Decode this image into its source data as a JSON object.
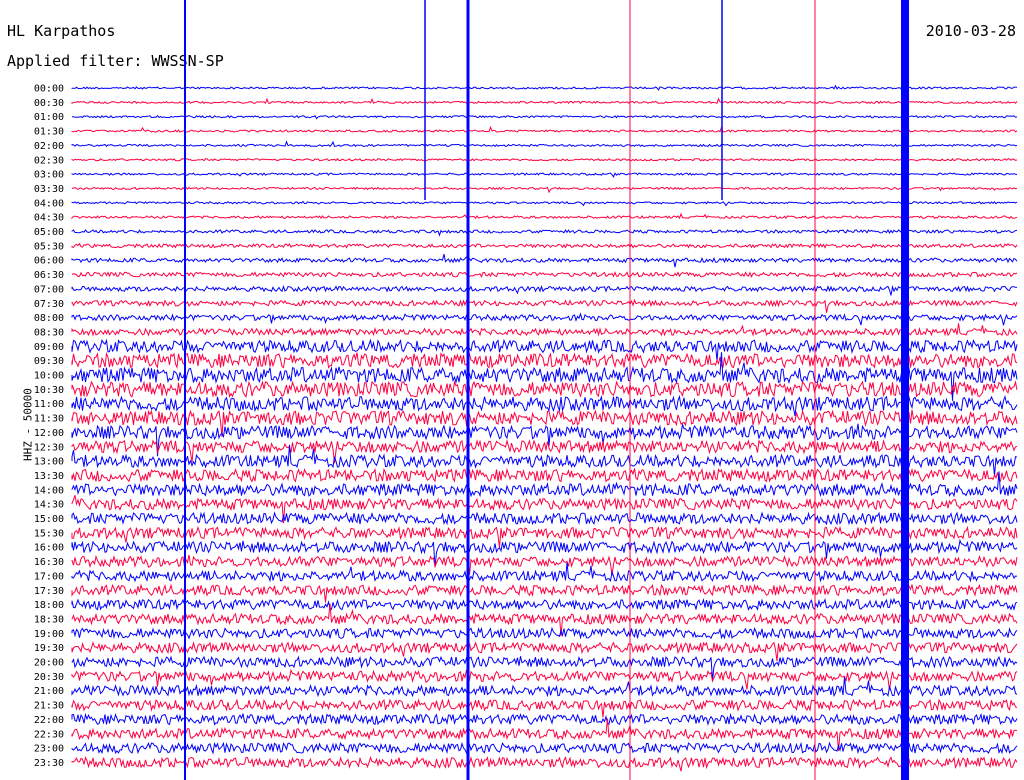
{
  "header": {
    "station": "HL Karpathos",
    "filter": "Applied filter: WWSSN-SP",
    "date": "2010-03-28",
    "channel": "HHZ - 50000"
  },
  "colors": {
    "trace_a": "#0000ff",
    "trace_b": "#ff0040"
  },
  "chart_data": {
    "type": "line",
    "title": "HL Karpathos",
    "subtitle": "Applied filter: WWSSN-SP",
    "ylabel": "HHZ - 50000",
    "y_tick_labels": [
      "00:00",
      "00:30",
      "01:00",
      "01:30",
      "02:00",
      "02:30",
      "03:00",
      "03:30",
      "04:00",
      "04:30",
      "05:00",
      "05:30",
      "06:00",
      "06:30",
      "07:00",
      "07:30",
      "08:00",
      "08:30",
      "09:00",
      "09:30",
      "10:00",
      "10:30",
      "11:00",
      "11:30",
      "12:00",
      "12:30",
      "13:00",
      "13:30",
      "14:00",
      "14:30",
      "15:00",
      "15:30",
      "16:00",
      "16:30",
      "17:00",
      "17:30",
      "18:00",
      "18:30",
      "19:00",
      "19:30",
      "20:00",
      "20:30",
      "21:00",
      "21:30",
      "22:00",
      "22:30",
      "23:00",
      "23:30"
    ],
    "series_colors": [
      "#0000ff",
      "#ff0040"
    ],
    "noise_level": [
      1,
      1,
      1,
      1,
      1,
      1,
      1,
      1,
      1,
      1.2,
      1.5,
      1.8,
      2,
      2.2,
      2.4,
      2.6,
      2.8,
      3.2,
      6,
      7,
      7.5,
      7.5,
      7,
      7,
      6.5,
      6,
      6,
      6,
      6,
      5.5,
      5.5,
      5.5,
      5.5,
      5,
      5,
      5,
      5,
      5,
      5,
      5,
      5,
      5,
      5,
      5,
      5,
      5,
      5,
      5
    ],
    "notes": "Helicorder: 48 half-hour traces alternating blue/red"
  }
}
